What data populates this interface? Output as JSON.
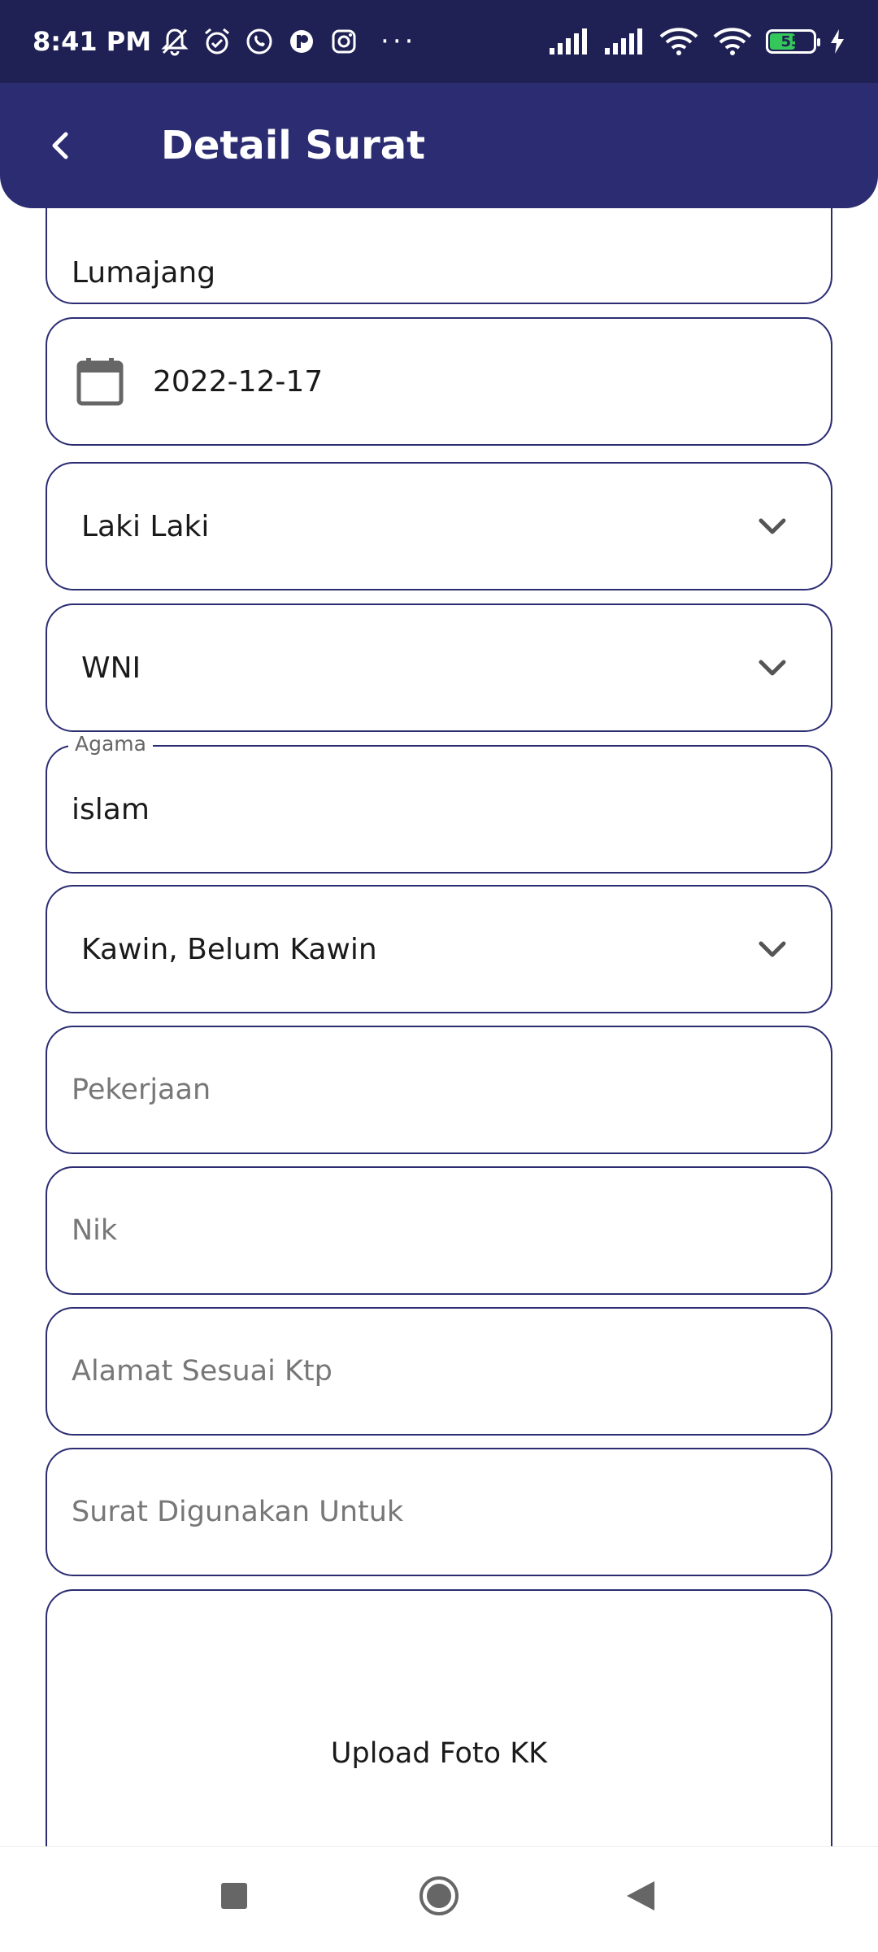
{
  "status_bar": {
    "time": "8:41 PM",
    "left_icons": [
      "bell-off-icon",
      "alarm-icon",
      "whatsapp-icon",
      "app-icon",
      "instagram-icon"
    ],
    "more": "···",
    "battery_level": "55",
    "battery_color": "#34c759"
  },
  "app_bar": {
    "title": "Detail Surat",
    "background": "#2b2c72"
  },
  "form": {
    "tempat_lahir": {
      "value": "Lumajang"
    },
    "tanggal_lahir": {
      "value": "2022-12-17"
    },
    "jenis_kelamin": {
      "value": "Laki Laki"
    },
    "kewarganegaraan": {
      "value": "WNI"
    },
    "agama": {
      "label": "Agama",
      "value": "islam"
    },
    "status_perkawinan": {
      "value": "Kawin, Belum Kawin"
    },
    "pekerjaan": {
      "placeholder": "Pekerjaan"
    },
    "nik": {
      "placeholder": "Nik"
    },
    "alamat": {
      "placeholder": "Alamat Sesuai Ktp"
    },
    "keperluan": {
      "placeholder": "Surat Digunakan Untuk"
    },
    "upload": {
      "label": "Upload Foto KK"
    }
  },
  "nav_bar": {
    "buttons": [
      "recent-apps-button",
      "home-button",
      "back-button"
    ]
  }
}
